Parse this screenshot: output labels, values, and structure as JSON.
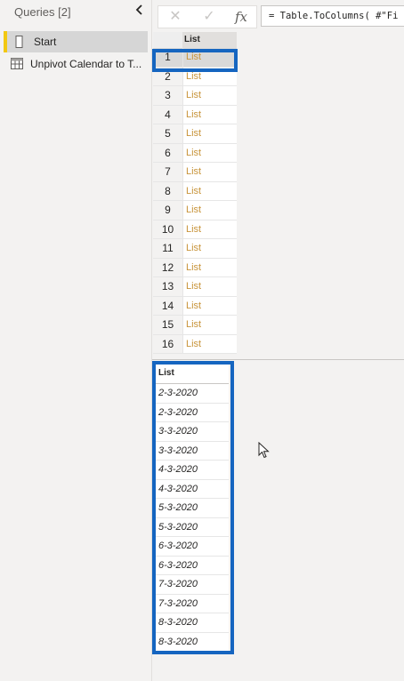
{
  "queries": {
    "title": "Queries [2]",
    "items": [
      {
        "label": "Start",
        "icon": "blank-query-icon",
        "selected": true
      },
      {
        "label": "Unpivot Calendar to T...",
        "icon": "table-icon",
        "selected": false
      }
    ]
  },
  "formula_bar": {
    "cancel_icon": "✕",
    "commit_icon": "✓",
    "fx_label": "fx",
    "formula": "= Table.ToColumns( #\"Fi"
  },
  "top_grid": {
    "column_header": "List",
    "rows": [
      {
        "index": "1",
        "value": "List"
      },
      {
        "index": "2",
        "value": "List"
      },
      {
        "index": "3",
        "value": "List"
      },
      {
        "index": "4",
        "value": "List"
      },
      {
        "index": "5",
        "value": "List"
      },
      {
        "index": "6",
        "value": "List"
      },
      {
        "index": "7",
        "value": "List"
      },
      {
        "index": "8",
        "value": "List"
      },
      {
        "index": "9",
        "value": "List"
      },
      {
        "index": "10",
        "value": "List"
      },
      {
        "index": "11",
        "value": "List"
      },
      {
        "index": "12",
        "value": "List"
      },
      {
        "index": "13",
        "value": "List"
      },
      {
        "index": "14",
        "value": "List"
      },
      {
        "index": "15",
        "value": "List"
      },
      {
        "index": "16",
        "value": "List"
      }
    ]
  },
  "bottom_grid": {
    "column_header": "List",
    "values": [
      "2-3-2020",
      "2-3-2020",
      "3-3-2020",
      "3-3-2020",
      "4-3-2020",
      "4-3-2020",
      "5-3-2020",
      "5-3-2020",
      "6-3-2020",
      "6-3-2020",
      "7-3-2020",
      "7-3-2020",
      "8-3-2020",
      "8-3-2020"
    ]
  },
  "colors": {
    "accent_highlight": "#1565c0",
    "selected_query_bar": "#f2c811",
    "list_link": "#c8943a"
  }
}
